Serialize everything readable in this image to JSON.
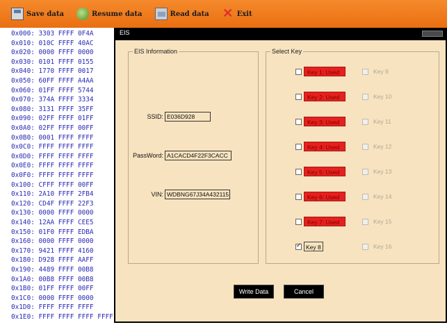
{
  "toolbar": {
    "items": [
      {
        "label": "Save data",
        "icon": "save-icon"
      },
      {
        "label": "Resume data",
        "icon": "resume-icon"
      },
      {
        "label": "Read data",
        "icon": "read-icon"
      },
      {
        "label": "Exit",
        "icon": "exit-icon"
      }
    ]
  },
  "hexdump": {
    "rows": [
      {
        "addr": "0x000:",
        "w1": "3303",
        "w2": "FFFF",
        "w3": "0F4A"
      },
      {
        "addr": "0x010:",
        "w1": "010C",
        "w2": "FFFF",
        "w3": "40AC"
      },
      {
        "addr": "0x020:",
        "w1": "0000",
        "w2": "FFFF",
        "w3": "0000"
      },
      {
        "addr": "0x030:",
        "w1": "0101",
        "w2": "FFFF",
        "w3": "0155"
      },
      {
        "addr": "0x040:",
        "w1": "1770",
        "w2": "FFFF",
        "w3": "0017"
      },
      {
        "addr": "0x050:",
        "w1": "60FF",
        "w2": "FFFF",
        "w3": "A4AA"
      },
      {
        "addr": "0x060:",
        "w1": "01FF",
        "w2": "FFFF",
        "w3": "5744"
      },
      {
        "addr": "0x070:",
        "w1": "374A",
        "w2": "FFFF",
        "w3": "3334"
      },
      {
        "addr": "0x080:",
        "w1": "3131",
        "w2": "FFFF",
        "w3": "35FF"
      },
      {
        "addr": "0x090:",
        "w1": "02FF",
        "w2": "FFFF",
        "w3": "01FF"
      },
      {
        "addr": "0x0A0:",
        "w1": "02FF",
        "w2": "FFFF",
        "w3": "00FF"
      },
      {
        "addr": "0x0B0:",
        "w1": "0001",
        "w2": "FFFF",
        "w3": "FFFF"
      },
      {
        "addr": "0x0C0:",
        "w1": "FFFF",
        "w2": "FFFF",
        "w3": "FFFF"
      },
      {
        "addr": "0x0D0:",
        "w1": "FFFF",
        "w2": "FFFF",
        "w3": "FFFF"
      },
      {
        "addr": "0x0E0:",
        "w1": "FFFF",
        "w2": "FFFF",
        "w3": "FFFF"
      },
      {
        "addr": "0x0F0:",
        "w1": "FFFF",
        "w2": "FFFF",
        "w3": "FFFF"
      },
      {
        "addr": "0x100:",
        "w1": "CFFF",
        "w2": "FFFF",
        "w3": "00FF"
      },
      {
        "addr": "0x110:",
        "w1": "2A10",
        "w2": "FFFF",
        "w3": "2FB4"
      },
      {
        "addr": "0x120:",
        "w1": "CD4F",
        "w2": "FFFF",
        "w3": "22F3"
      },
      {
        "addr": "0x130:",
        "w1": "0000",
        "w2": "FFFF",
        "w3": "0000"
      },
      {
        "addr": "0x140:",
        "w1": "12AA",
        "w2": "FFFF",
        "w3": "CEE5"
      },
      {
        "addr": "0x150:",
        "w1": "01F0",
        "w2": "FFFF",
        "w3": "EDBA"
      },
      {
        "addr": "0x160:",
        "w1": "0000",
        "w2": "FFFF",
        "w3": "0000"
      },
      {
        "addr": "0x170:",
        "w1": "9421",
        "w2": "FFFF",
        "w3": "4160"
      },
      {
        "addr": "0x180:",
        "w1": "D928",
        "w2": "FFFF",
        "w3": "AAFF"
      },
      {
        "addr": "0x190:",
        "w1": "4489",
        "w2": "FFFF",
        "w3": "00B8"
      },
      {
        "addr": "0x1A0:",
        "w1": "00B8",
        "w2": "FFFF",
        "w3": "00B8"
      },
      {
        "addr": "0x1B0:",
        "w1": "01FF",
        "w2": "FFFF",
        "w3": "00FF"
      },
      {
        "addr": "0x1C0:",
        "w1": "0000",
        "w2": "FFFF",
        "w3": "0000"
      },
      {
        "addr": "0x1D0:",
        "w1": "FFFF",
        "w2": "FFFF",
        "w3": "FFFF"
      },
      {
        "addr": "0x1E0:",
        "w1": "FFFF",
        "w2": "FFFF",
        "w3": "FFFF",
        "tail": "FFFF FFFF FFFF FFFF FFFF    ................"
      }
    ]
  },
  "dialog": {
    "title": "EIS",
    "eis_info": {
      "group_title": "EIS Information",
      "ssid_label": "SSID:",
      "ssid_value": "E036D928",
      "password_label": "PassWord:",
      "password_value": "A1CACD4F22F3CACC",
      "vin_label": "VIN:",
      "vin_value": "WDBNG67J34A432115"
    },
    "select_key": {
      "group_title": "Select Key",
      "left_keys": [
        {
          "label": "Key 1: Used",
          "used": true
        },
        {
          "label": "Key 2: Used",
          "used": true
        },
        {
          "label": "Key 3: Used",
          "used": true
        },
        {
          "label": "Key 4: Used",
          "used": true
        },
        {
          "label": "Key 5: Used",
          "used": true
        },
        {
          "label": "Key 6: Used",
          "used": true
        },
        {
          "label": "Key 7: Used",
          "used": true
        },
        {
          "label": "Key 8",
          "used": false,
          "checked": true
        }
      ],
      "right_keys": [
        {
          "label": "Key 9"
        },
        {
          "label": "Key 10"
        },
        {
          "label": "Key 11"
        },
        {
          "label": "Key 12"
        },
        {
          "label": "Key 13"
        },
        {
          "label": "Key 14"
        },
        {
          "label": "Key 15"
        },
        {
          "label": "Key 16"
        }
      ]
    },
    "write_button": "Write Data",
    "cancel_button": "Cancel"
  },
  "colors": {
    "toolbar": "#f07d20",
    "dialog_body": "#f7e3bf",
    "used_key": "#e8201d",
    "hex_text": "#2a2ab8"
  }
}
